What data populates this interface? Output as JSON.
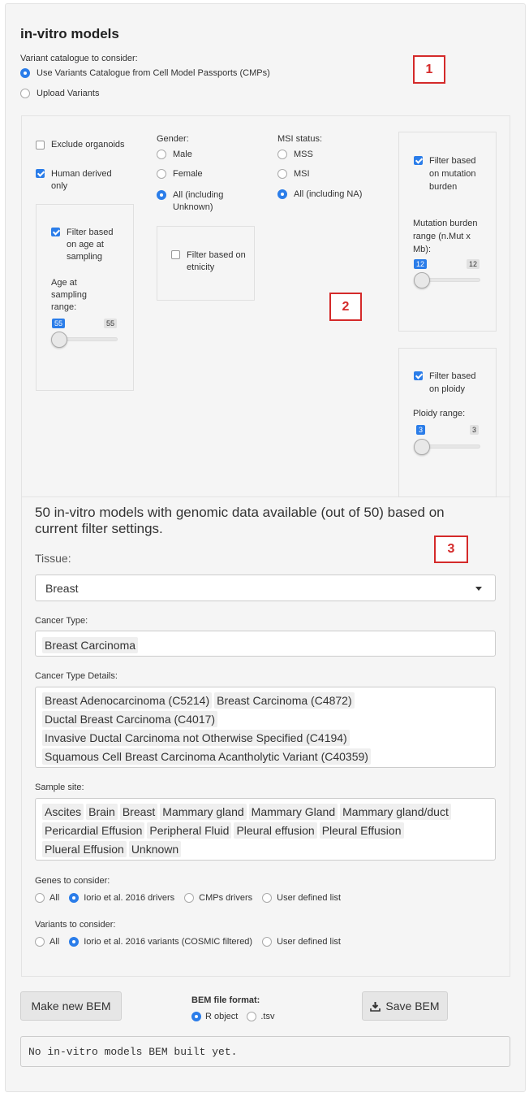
{
  "title": "in-vitro models",
  "variant_catalogue": {
    "label": "Variant catalogue to consider:",
    "options": [
      "Use Variants Catalogue from Cell Model Passports (CMPs)",
      "Upload Variants"
    ],
    "selected": 0
  },
  "markers": [
    "1",
    "2",
    "3"
  ],
  "filters": {
    "exclude_organoids": "Exclude organoids",
    "human_derived": "Human derived only",
    "gender": {
      "label": "Gender:",
      "options": [
        "Male",
        "Female",
        "All (including Unknown)"
      ]
    },
    "msi": {
      "label": "MSI status:",
      "options": [
        "MSS",
        "MSI",
        "All (including NA)"
      ]
    },
    "age": {
      "check": "Filter based on age at sampling",
      "range_label": "Age at sampling range:",
      "value": "55",
      "max": "55"
    },
    "ethnicity": {
      "check": "Filter based on etnicity"
    },
    "mutation": {
      "check": "Filter based on mutation burden",
      "range_label": "Mutation burden range (n.Mut x Mb):",
      "value": "12",
      "max": "12"
    },
    "ploidy": {
      "check": "Filter based on ploidy",
      "range_label": "Ploidy range:",
      "value": "3",
      "max": "3"
    }
  },
  "summary": "50 in-vitro models with genomic data available (out of 50) based on current filter settings.",
  "tissue": {
    "label": "Tissue:",
    "value": "Breast"
  },
  "cancer_type": {
    "label": "Cancer Type:",
    "tags": [
      "Breast Carcinoma"
    ]
  },
  "cancer_type_details": {
    "label": "Cancer Type Details:",
    "tags": [
      "Breast Adenocarcinoma (C5214)",
      "Breast Carcinoma (C4872)",
      "Ductal Breast Carcinoma (C4017)",
      "Invasive Ductal Carcinoma not Otherwise Specified (C4194)",
      "Squamous Cell Breast Carcinoma Acantholytic Variant (C40359)"
    ]
  },
  "sample_site": {
    "label": "Sample site:",
    "tags": [
      "Ascites",
      "Brain",
      "Breast",
      "Mammary gland",
      "Mammary Gland",
      "Mammary gland/duct",
      "Pericardial Effusion",
      "Peripheral Fluid",
      "Pleural effusion",
      "Pleural Effusion",
      "Plueral Effusion",
      "Unknown"
    ]
  },
  "genes": {
    "label": "Genes to consider:",
    "options": [
      "All",
      "Iorio et al. 2016 drivers",
      "CMPs drivers",
      "User defined list"
    ],
    "selected": 1
  },
  "variants": {
    "label": "Variants to consider:",
    "options": [
      "All",
      "Iorio et al. 2016 variants (COSMIC filtered)",
      "User defined list"
    ],
    "selected": 1
  },
  "actions": {
    "make_bem": "Make new BEM",
    "format_label": "BEM file format:",
    "format_options": [
      "R object",
      ".tsv"
    ],
    "save_bem": "Save BEM"
  },
  "output": "No in-vitro models BEM built yet."
}
